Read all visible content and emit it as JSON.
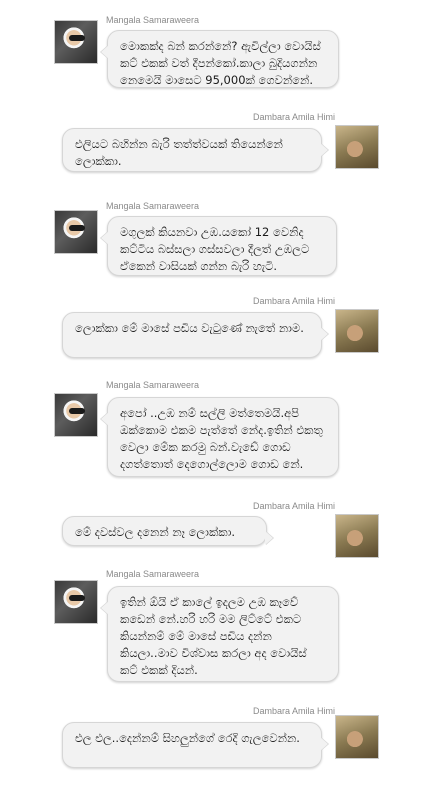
{
  "messages": [
    {
      "sender": "Mangala Samaraweera",
      "side": "left",
      "text": "මොකක්ද බන් කරන්නේ? ඇවිල්ලා වොයිස් කට් එකක් වත් දීපන්කෝ.කාලා බුදියගන්න නෙමෙයි මාසෙට 95,000ක් ගෙවන්නේ."
    },
    {
      "sender": "Dambara Amila Himi",
      "side": "right",
      "text": "එලියට බහින්න බැරි තත්ත්වයක් තියෙන්නේ ලොක්කා."
    },
    {
      "sender": "Mangala Samaraweera",
      "side": "left",
      "text": "මගුලක් කියනවා උඹ.යකෝ 12 වෙනිද කට්ටිය බස්සලා ගස්සවලා දීලත් උඹලට ඒකෙන් වාසියක් ගන්න බැරි හැටි."
    },
    {
      "sender": "Dambara Amila Himi",
      "side": "right",
      "text": "ලොක්කා මේ මාසේ පඩිය වැටුණේ නැතේ නාම."
    },
    {
      "sender": "Mangala Samaraweera",
      "side": "left",
      "text": "අපෝ ..උඹ නම් සල්ලි මත්තෙමයි.අපි ඔක්කොම එකම පැත්තේ නේද.ඉතින් එකතු වෙලා මේක කරමු බන්.වැඩේ ගොඩ දගත්තොත් දෙගොල්ලොම ගොඩ නේ."
    },
    {
      "sender": "Dambara Amila Himi",
      "side": "right",
      "text": "මේ දවස්වල දනෙන් නෑ ලොක්කා."
    },
    {
      "sender": "Mangala Samaraweera",
      "side": "left",
      "text": "ඉතින් ඕයි ඒ කාලේ ඉදලම උඹ කෑවේ කඩෙන් නේ.හරි හරි මම ලිට්ටේ එකට කියන්නම් මේ මාසේ පඩිය දන්න කියලා..මාව විශ්වාස කරලා අද වොයිස් කට් එකක් දියන්."
    },
    {
      "sender": "Dambara Amila Himi",
      "side": "right",
      "text": "එල එල..දෙන්නම් සිහලුන්ගේ රෙදි ගැලවෙන්න."
    }
  ]
}
